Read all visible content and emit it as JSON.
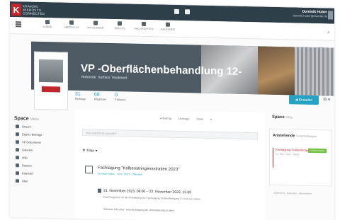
{
  "topbar": {
    "logo_lines": [
      "KRAMSKI",
      "MIKROSYS",
      "CONNECTED"
    ],
    "user_name": "Dominik Huber",
    "user_email": "dominik.huber@kramski.de"
  },
  "nav": {
    "items": [
      {
        "label": "Kunde",
        "icon": "dashboard-icon"
      },
      {
        "label": "Übersicht",
        "icon": "overview-icon"
      },
      {
        "label": "Mitglieder",
        "icon": "people-icon"
      },
      {
        "label": "Spaces",
        "icon": "spaces-icon"
      },
      {
        "label": "Nachrichten",
        "icon": "mail-icon"
      },
      {
        "label": "Kalender",
        "icon": "calendar-icon"
      }
    ]
  },
  "space": {
    "title": "VP -Oberflächenbehandlung 12-",
    "subtitle": "Verbünde: Surface Treatment",
    "counters": [
      {
        "value": "31",
        "label": "Beiträge"
      },
      {
        "value": "68",
        "label": "Mitglieder"
      },
      {
        "value": "0",
        "label": "Follower"
      }
    ],
    "join_label": "◀ Einladen",
    "settings_label": "⚙ ▾"
  },
  "sidebar": {
    "title": "Space",
    "title_suffix": "Menü",
    "items": [
      {
        "label": "Stream",
        "icon": "stream-icon"
      },
      {
        "label": "Eigene Beiträge",
        "icon": "posts-icon"
      },
      {
        "label": "VP Dokumente",
        "icon": "folder-icon"
      },
      {
        "label": "Galerien",
        "icon": "image-icon"
      },
      {
        "label": "Wiki",
        "icon": "wiki-icon"
      },
      {
        "label": "Dateien",
        "icon": "file-icon"
      },
      {
        "label": "Kalender",
        "icon": "calendar-icon"
      },
      {
        "label": "Über",
        "icon": "info-icon"
      }
    ]
  },
  "stream": {
    "filters": [
      "● Beitrag",
      "Umfrage",
      "Datei",
      "▾"
    ],
    "composer_placeholder": "Was machst du gerade?",
    "tag_filter": "▼ Filter ▾",
    "entry": {
      "title": "Fachtagung \"Kolbenstringensstratien 2023\"",
      "meta": "Dominik Huber · 10.07.2023 · Öffentlich",
      "date": "21. November 2023, 09:00 – 22. November 2023, 15:00",
      "description": "Das Programm ist die Anmeldung zur Fachtagung \"Kolbenfertigung Z\" sind nun online.",
      "link": "Schauen Sie unter: www.fachtagung.de, Anmeldeschluss über."
    }
  },
  "rightcol": {
    "title": "Space",
    "title_suffix": "Infos",
    "box_title": "Anstehende",
    "box_title_suffix": "Veranstaltungen",
    "event_title": "Fachtagung \"Kolbenfertigungen 2023\"",
    "event_date": "21. Nov. 2023 · 09:00",
    "event_badge": "INTERESSIERT",
    "links": "Übersicht · Kalender · Abonnieren"
  }
}
